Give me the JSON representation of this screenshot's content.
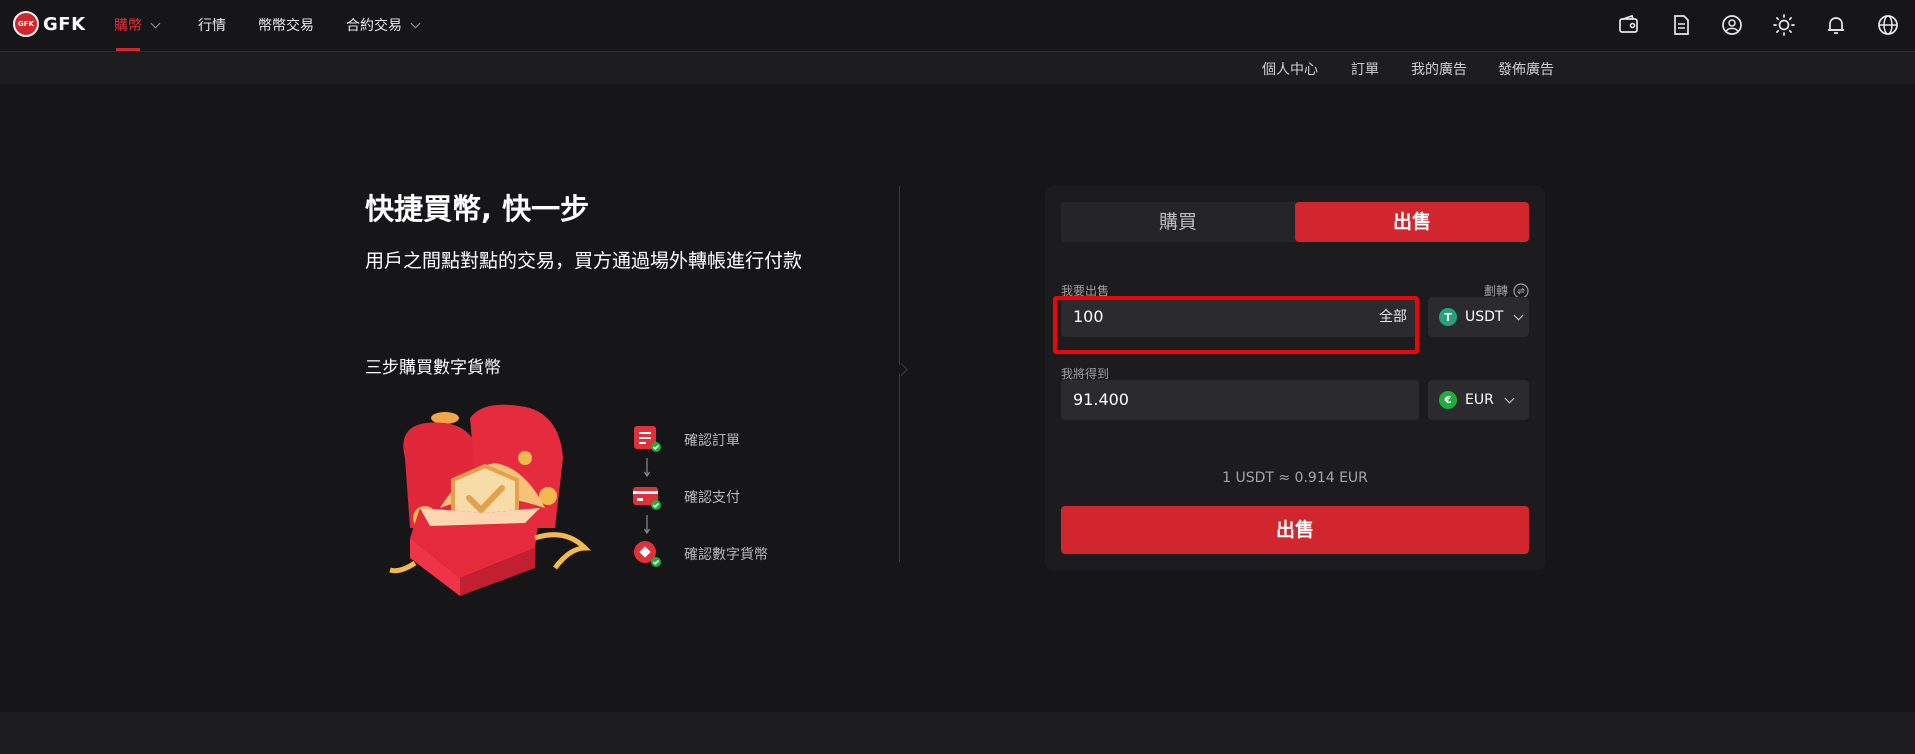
{
  "header": {
    "logo_text": "GFK",
    "logo_badge": "GFK",
    "nav": [
      {
        "label": "購幣",
        "active": true,
        "has_dropdown": true
      },
      {
        "label": "行情",
        "active": false,
        "has_dropdown": false
      },
      {
        "label": "幣幣交易",
        "active": false,
        "has_dropdown": false
      },
      {
        "label": "合約交易",
        "active": false,
        "has_dropdown": true
      }
    ],
    "icons": [
      "wallet-icon",
      "orders-icon",
      "user-icon",
      "theme-sun-icon",
      "bell-icon",
      "globe-icon"
    ]
  },
  "subnav": [
    "個人中心",
    "訂單",
    "我的廣告",
    "發佈廣告"
  ],
  "hero": {
    "title": "快捷買幣, 快一步",
    "subtitle": "用戶之間點對點的交易，買方通過場外轉帳進行付款"
  },
  "steps": {
    "title": "三步購買數字貨幣",
    "items": [
      "確認訂單",
      "確認支付",
      "確認數字貨幣"
    ]
  },
  "trade": {
    "tabs": [
      "購買",
      "出售"
    ],
    "active_tab": "出售",
    "sell_label": "我要出售",
    "transfer_label": "劃轉",
    "sell_amount": "100",
    "all_label": "全部",
    "sell_currency": "USDT",
    "receive_label": "我將得到",
    "receive_amount": "91.400",
    "receive_currency": "EUR",
    "rate_text": "1 USDT ≈ 0.914 EUR",
    "submit_label": "出售"
  },
  "colors": {
    "accent": "#d1262e",
    "background": "#161618",
    "card": "#1c1c1e",
    "highlight": "#e8070b",
    "usdt": "#26a17b",
    "eur": "#1fae3c"
  }
}
